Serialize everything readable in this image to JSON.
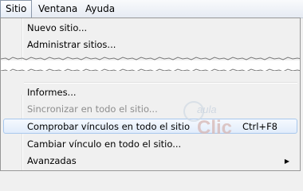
{
  "menubar": {
    "items": [
      {
        "label": "Sitio"
      },
      {
        "label": "Ventana"
      },
      {
        "label": "Ayuda"
      }
    ]
  },
  "menu": {
    "items": [
      {
        "label": "Nuevo sitio..."
      },
      {
        "label": "Administrar sitios..."
      },
      {
        "label": "Informes..."
      },
      {
        "label": "Sincronizar en todo el sitio..."
      },
      {
        "label": "Comprobar vínculos en todo el sitio",
        "shortcut": "Ctrl+F8"
      },
      {
        "label": "Cambiar vínculo en todo el sitio..."
      },
      {
        "label": "Avanzadas"
      }
    ]
  },
  "watermark": {
    "line1": "aula",
    "line2": "Clic"
  }
}
